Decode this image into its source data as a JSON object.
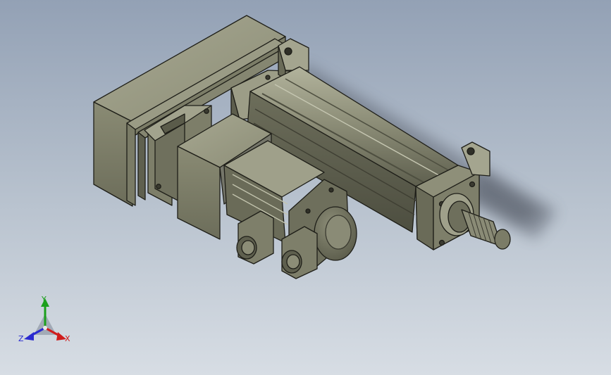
{
  "viewport": {
    "background_top": "#93a1b5",
    "background_bottom": "#d7dde4",
    "model_color": "#8b8c76"
  },
  "triad": {
    "x_label": "X",
    "y_label": "Y",
    "z_label": "Z",
    "x_color": "#d01c1c",
    "y_color": "#1ca01c",
    "z_color": "#2a2ad0"
  }
}
